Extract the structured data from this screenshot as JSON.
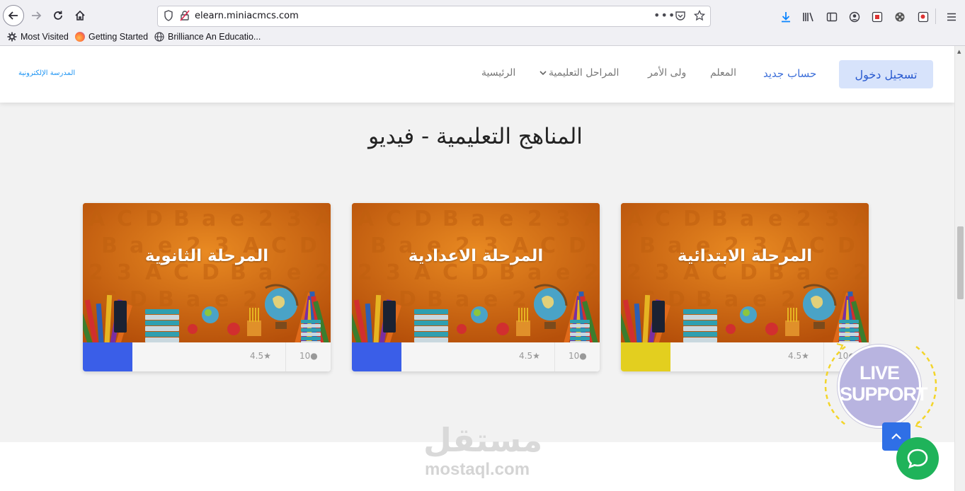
{
  "browser": {
    "url_domain": "elearn.miniacmcs.com",
    "bookmarks": [
      {
        "label": "Most Visited",
        "icon": "gear-icon"
      },
      {
        "label": "Getting Started",
        "icon": "firefox-icon"
      },
      {
        "label": "Brilliance An Educatio...",
        "icon": "globe-icon"
      }
    ]
  },
  "header": {
    "logo": "المدرسة الإلكترونية",
    "menu": {
      "home": "الرئيسية",
      "stages": "المراحل التعليمية",
      "guardian": "ولى الأمر",
      "teacher": "المعلم",
      "register": "حساب جديد",
      "login": "تسجيل دخول"
    }
  },
  "section": {
    "title": "المناهج التعليمية - فيديو"
  },
  "cards": [
    {
      "title": "المرحلة الثانوية",
      "rating": "4.5",
      "count": "10",
      "accent": "#3a5ee8"
    },
    {
      "title": "المرحلة الاعدادية",
      "rating": "4.5",
      "count": "10",
      "accent": "#3a5ee8"
    },
    {
      "title": "المرحلة الابتدائية",
      "rating": "4.5",
      "count": "10",
      "accent": "#e3cf1f"
    }
  ],
  "support": {
    "line1": "LIVE",
    "line2": "SUPPORT"
  },
  "watermark": {
    "arabic": "مستقل",
    "latin": "mostaql.com"
  },
  "colors": {
    "brand_blue": "#2a5bd0",
    "card_orange": "#d76b10",
    "chat_green": "#1fb35a"
  }
}
